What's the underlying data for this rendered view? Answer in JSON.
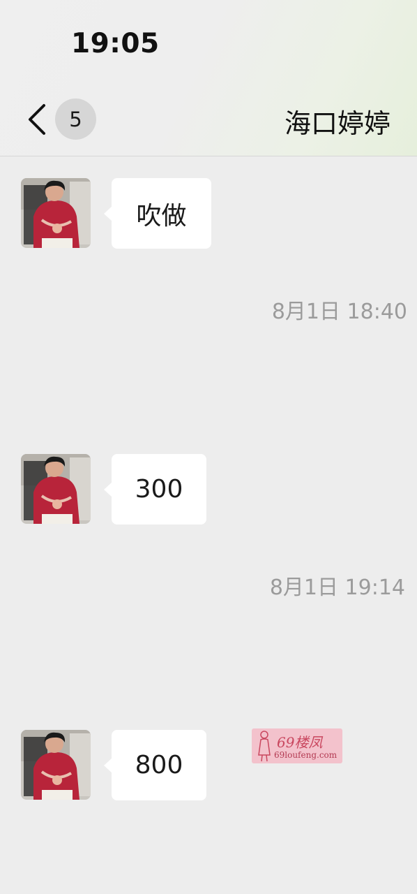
{
  "status_bar": {
    "time": "19:05"
  },
  "header": {
    "unread_count": "5",
    "title": "海口婷婷"
  },
  "messages": [
    {
      "sender": "contact",
      "text": "吹做"
    },
    {
      "type": "timestamp",
      "text": "8月1日 18:40"
    },
    {
      "sender": "contact",
      "text": "300"
    },
    {
      "type": "timestamp",
      "text": "8月1日 19:14"
    },
    {
      "sender": "contact",
      "text": "800"
    }
  ],
  "watermark": {
    "title": "69楼凤",
    "url": "69loufeng.com"
  },
  "colors": {
    "background": "#ededed",
    "bubble": "#ffffff",
    "timestamp": "#9b9b9b",
    "badge": "#d6d6d6",
    "avatar_dress": "#b8243a"
  },
  "icons": [
    "back-chevron-icon",
    "contact-avatar"
  ]
}
